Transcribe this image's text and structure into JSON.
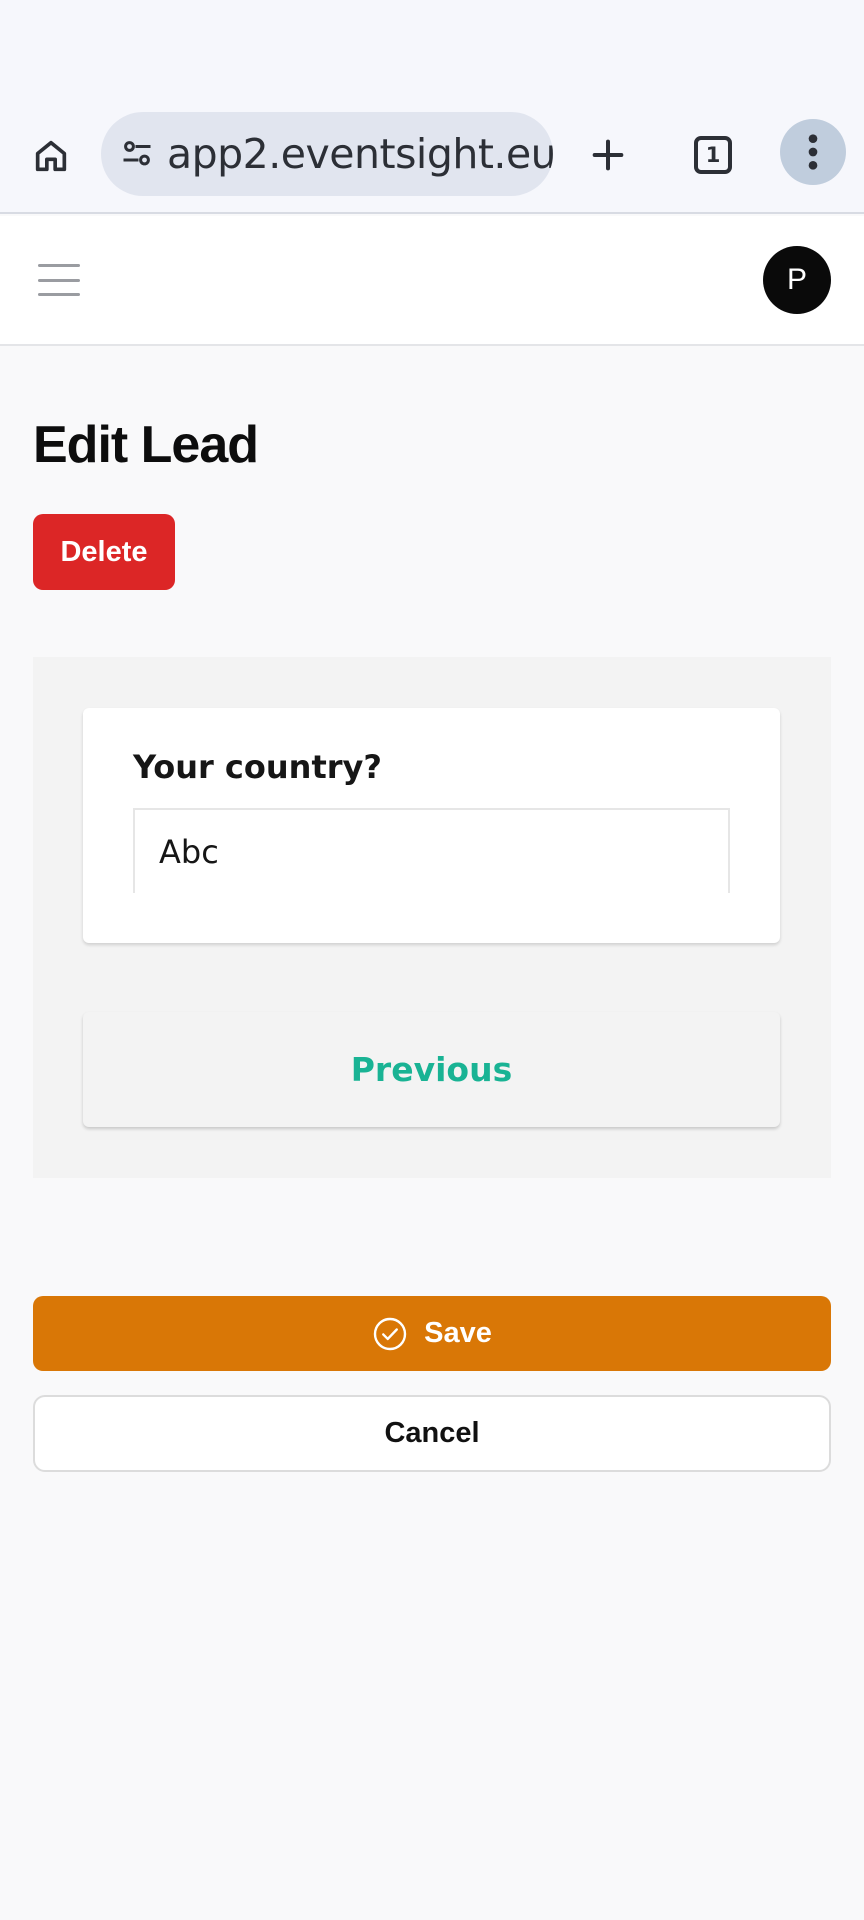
{
  "browser": {
    "url": "app2.eventsight.eu",
    "tab_count": "1",
    "icons": [
      "home-icon",
      "site-settings-icon",
      "new-tab-plus-icon",
      "tab-switcher-icon",
      "more-menu-icon"
    ]
  },
  "header": {
    "avatar_initial": "P",
    "menu_icon": "hamburger-menu-icon"
  },
  "page": {
    "title": "Edit Lead",
    "delete_label": "Delete"
  },
  "survey": {
    "question_label": "Your country?",
    "answer_value": "Abc",
    "previous_label": "Previous"
  },
  "actions": {
    "save_label": "Save",
    "save_icon": "check-circle-icon",
    "cancel_label": "Cancel"
  },
  "colors": {
    "delete": "#dc2626",
    "save": "#d97706",
    "previous_text": "#19b394"
  }
}
